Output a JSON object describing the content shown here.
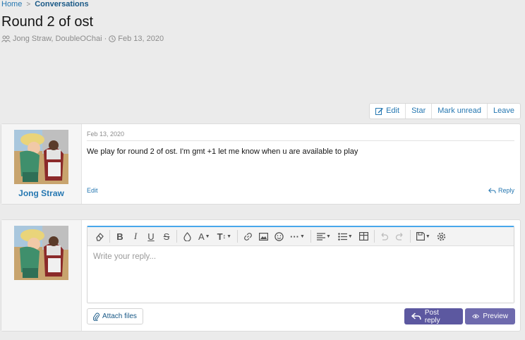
{
  "breadcrumb": {
    "home": "Home",
    "separator": ">",
    "conversations": "Conversations"
  },
  "page": {
    "title": "Round 2 of ost",
    "participants": "Jong Straw, DoubleOChai",
    "dot": "·",
    "date": "Feb 13, 2020"
  },
  "actions": {
    "edit": "Edit",
    "star": "Star",
    "mark_unread": "Mark unread",
    "leave": "Leave"
  },
  "message": {
    "username": "Jong Straw",
    "date": "Feb 13, 2020",
    "body": "We play for round 2 of ost. I'm gmt +1 let me know when u are available to play",
    "edit": "Edit",
    "reply": "Reply"
  },
  "reply_form": {
    "placeholder": "Write your reply...",
    "attach": "Attach files",
    "post": "Post reply",
    "preview": "Preview"
  },
  "toolbar_icons": [
    "eraser-icon",
    "bold-icon",
    "italic-icon",
    "underline-icon",
    "strikethrough-icon",
    "color-icon",
    "font-size-icon",
    "text-size-icon",
    "link-icon",
    "image-icon",
    "smilie-icon",
    "more-icon",
    "align-icon",
    "list-icon",
    "table-icon",
    "undo-icon",
    "redo-icon",
    "drafts-icon",
    "settings-icon"
  ],
  "colors": {
    "link": "#2577b1",
    "accent": "#47a7eb",
    "button": "#5c58a0",
    "button_alt": "#6e6aad"
  }
}
